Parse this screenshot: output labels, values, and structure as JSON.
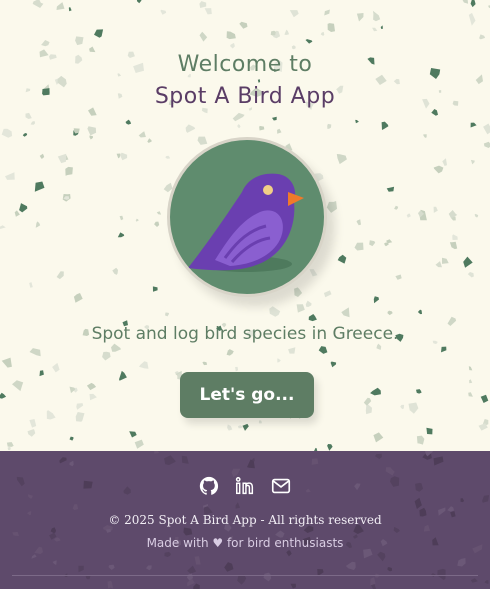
{
  "hero": {
    "welcome_line1": "Welcome to",
    "welcome_line2": "Spot A Bird App",
    "tagline": "Spot and log bird species in Greece.",
    "cta_label": "Let's go..."
  },
  "footer": {
    "copyright": "© 2025 Spot A Bird App - All rights reserved",
    "made_with": "Made with ♥ for bird enthusiasts",
    "social": [
      "github-icon",
      "linkedin-icon",
      "mail-icon"
    ]
  },
  "colors": {
    "background": "#fbf9ec",
    "primary_green": "#5e7d64",
    "accent_purple": "#5a3d66",
    "footer_bg": "#5e4a6b",
    "bird": "#6a3fb0",
    "beak": "#f07a2a"
  }
}
